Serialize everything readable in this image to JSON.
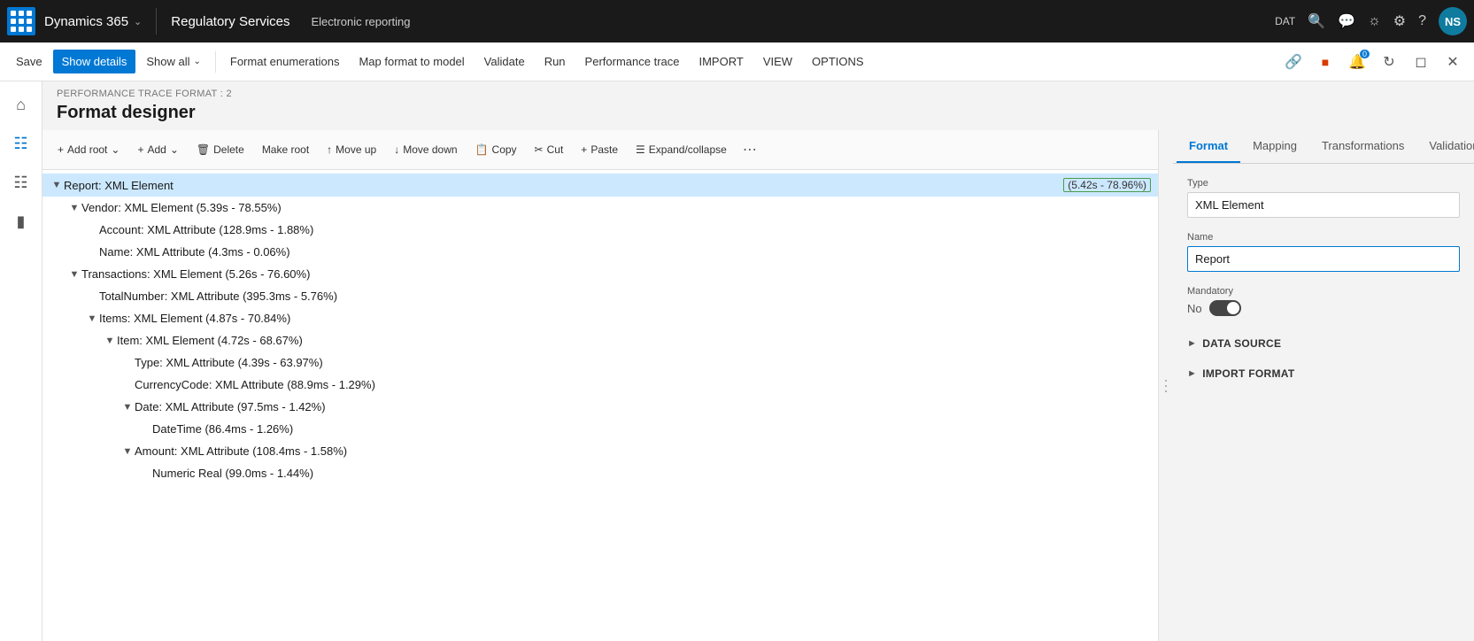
{
  "topNav": {
    "appIcon": "grid",
    "brandName": "Dynamics 365",
    "moduleName": "Regulatory Services",
    "subNavLabel": "Electronic reporting",
    "envLabel": "DAT",
    "avatarLabel": "NS"
  },
  "commandBar": {
    "saveLabel": "Save",
    "showDetailsLabel": "Show details",
    "showAllLabel": "Show all",
    "formatEnumerationsLabel": "Format enumerations",
    "mapFormatLabel": "Map format to model",
    "validateLabel": "Validate",
    "runLabel": "Run",
    "performanceTraceLabel": "Performance trace",
    "importLabel": "IMPORT",
    "viewLabel": "VIEW",
    "optionsLabel": "OPTIONS"
  },
  "breadcrumb": "PERFORMANCE TRACE FORMAT : 2",
  "pageTitle": "Format designer",
  "treeToolbar": {
    "addRootLabel": "Add root",
    "addLabel": "Add",
    "deleteLabel": "Delete",
    "makeRootLabel": "Make root",
    "moveUpLabel": "Move up",
    "moveDownLabel": "Move down",
    "copyLabel": "Copy",
    "cutLabel": "Cut",
    "pasteLabel": "Paste",
    "expandCollapseLabel": "Expand/collapse"
  },
  "treeNodes": [
    {
      "id": "node-report",
      "label": "Report: XML Element",
      "perf": "(5.42s - 78.96%)",
      "indent": 0,
      "hasToggle": true,
      "selected": true
    },
    {
      "id": "node-vendor",
      "label": "Vendor: XML Element (5.39s - 78.55%)",
      "perf": "",
      "indent": 1,
      "hasToggle": true,
      "selected": false
    },
    {
      "id": "node-account",
      "label": "Account: XML Attribute (128.9ms - 1.88%)",
      "perf": "",
      "indent": 2,
      "hasToggle": false,
      "selected": false
    },
    {
      "id": "node-name",
      "label": "Name: XML Attribute (4.3ms - 0.06%)",
      "perf": "",
      "indent": 2,
      "hasToggle": false,
      "selected": false
    },
    {
      "id": "node-transactions",
      "label": "Transactions: XML Element (5.26s - 76.60%)",
      "perf": "",
      "indent": 1,
      "hasToggle": true,
      "selected": false
    },
    {
      "id": "node-totalnumber",
      "label": "TotalNumber: XML Attribute (395.3ms - 5.76%)",
      "perf": "",
      "indent": 2,
      "hasToggle": false,
      "selected": false
    },
    {
      "id": "node-items",
      "label": "Items: XML Element (4.87s - 70.84%)",
      "perf": "",
      "indent": 2,
      "hasToggle": true,
      "selected": false
    },
    {
      "id": "node-item",
      "label": "Item: XML Element (4.72s - 68.67%)",
      "perf": "",
      "indent": 3,
      "hasToggle": true,
      "selected": false
    },
    {
      "id": "node-type",
      "label": "Type: XML Attribute (4.39s - 63.97%)",
      "perf": "",
      "indent": 4,
      "hasToggle": false,
      "selected": false
    },
    {
      "id": "node-currencycode",
      "label": "CurrencyCode: XML Attribute (88.9ms - 1.29%)",
      "perf": "",
      "indent": 4,
      "hasToggle": false,
      "selected": false
    },
    {
      "id": "node-date",
      "label": "Date: XML Attribute (97.5ms - 1.42%)",
      "perf": "",
      "indent": 4,
      "hasToggle": true,
      "selected": false
    },
    {
      "id": "node-datetime",
      "label": "DateTime (86.4ms - 1.26%)",
      "perf": "",
      "indent": 5,
      "hasToggle": false,
      "selected": false
    },
    {
      "id": "node-amount",
      "label": "Amount: XML Attribute (108.4ms - 1.58%)",
      "perf": "",
      "indent": 4,
      "hasToggle": true,
      "selected": false
    },
    {
      "id": "node-numericreal",
      "label": "Numeric Real (99.0ms - 1.44%)",
      "perf": "",
      "indent": 5,
      "hasToggle": false,
      "selected": false
    }
  ],
  "rightPanel": {
    "tabs": [
      "Format",
      "Mapping",
      "Transformations",
      "Validations"
    ],
    "activeTab": "Format",
    "typeLabel": "Type",
    "typeValue": "XML Element",
    "nameLabel": "Name",
    "nameValue": "Report",
    "mandatoryLabel": "Mandatory",
    "mandatoryNoLabel": "No",
    "dataSourceLabel": "DATA SOURCE",
    "importFormatLabel": "IMPORT FORMAT"
  }
}
